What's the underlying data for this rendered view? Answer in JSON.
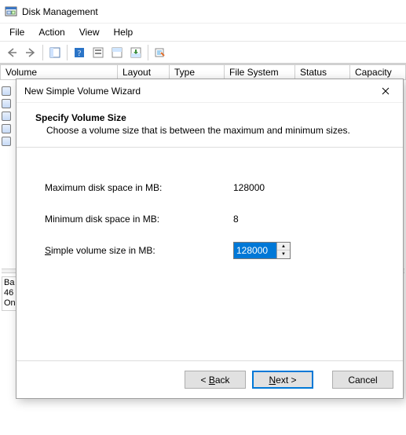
{
  "app": {
    "title": "Disk Management"
  },
  "menus": {
    "file": "File",
    "action": "Action",
    "view": "View",
    "help": "Help"
  },
  "columns": {
    "volume": "Volume",
    "layout": "Layout",
    "type": "Type",
    "filesystem": "File System",
    "status": "Status",
    "capacity": "Capacity"
  },
  "diskpane": {
    "l1": "Ba",
    "l2": "46",
    "l3": "On"
  },
  "wizard": {
    "title": "New Simple Volume Wizard",
    "heading": "Specify Volume Size",
    "description": "Choose a volume size that is between the maximum and minimum sizes.",
    "max_label": "Maximum disk space in MB:",
    "max_value": "128000",
    "min_label": "Minimum disk space in MB:",
    "min_value": "8",
    "size_label_pre": "S",
    "size_label_post": "imple volume size in MB:",
    "size_value": "128000",
    "back_pre": "< ",
    "back_u": "B",
    "back_post": "ack",
    "next_u": "N",
    "next_post": "ext >",
    "cancel": "Cancel"
  }
}
